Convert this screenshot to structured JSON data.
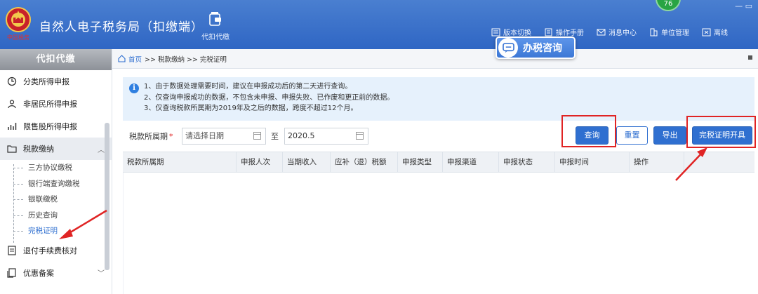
{
  "header": {
    "title": "自然人电子税务局（扣缴端）",
    "emblem_text": "中国税务",
    "module_tab": "代扣代缴",
    "badge": "76",
    "window_controls": "— ▭",
    "links": [
      {
        "label": "版本切换",
        "icon": "switch-icon"
      },
      {
        "label": "操作手册",
        "icon": "manual-icon"
      },
      {
        "label": "消息中心",
        "icon": "mail-icon"
      },
      {
        "label": "单位管理",
        "icon": "building-icon"
      },
      {
        "label": "离线",
        "icon": "offline-icon"
      }
    ]
  },
  "sidebar": {
    "title": "代扣代缴",
    "items": [
      {
        "label": "分类所得申报",
        "icon": "pie-clock-icon"
      },
      {
        "label": "非居民所得申报",
        "icon": "person-icon"
      },
      {
        "label": "限售股所得申报",
        "icon": "bar-chart-icon"
      },
      {
        "label": "税款缴纳",
        "icon": "folder-icon",
        "expanded": true
      },
      {
        "label": "退付手续费核对",
        "icon": "doc-icon"
      },
      {
        "label": "优惠备案",
        "icon": "doc-copy-icon"
      }
    ],
    "sub_items": [
      "三方协议缴税",
      "银行端查询缴税",
      "银联缴税",
      "历史查询",
      "完税证明"
    ],
    "selected_sub": "完税证明"
  },
  "breadcrumb": "首页 >> 税款缴纳 >> 完税证明",
  "breadcrumb_home": "首页",
  "breadcrumb_rest": ">> 税款缴纳 >> 完税证明",
  "consult_button": "办税咨询",
  "notice": {
    "lines": [
      "1、由于数据处理需要时间，建议在申报成功后的第二天进行查询。",
      "2、仅查询申报成功的数据，不包含未申报、申报失败、已作废和更正前的数据。",
      "3、仅查询税款所属期为2019年及之后的数据，跨度不超过12个月。"
    ]
  },
  "filter": {
    "label": "税款所属期",
    "required_mark": "*",
    "start_placeholder": "请选择日期",
    "to_label": "至",
    "end_value": "2020.5"
  },
  "buttons": {
    "query": "查询",
    "reset": "重置",
    "export": "导出",
    "issue_certificate": "完税证明开具"
  },
  "table": {
    "columns": [
      "税款所属期",
      "申报人次",
      "当期收入",
      "应补（退）税额",
      "申报类型",
      "申报渠道",
      "申报状态",
      "申报时间",
      "操作"
    ],
    "rows": []
  },
  "colors": {
    "header_blue": "#2f66c4",
    "primary": "#2f6fd0",
    "annotation_red": "#e02424"
  }
}
